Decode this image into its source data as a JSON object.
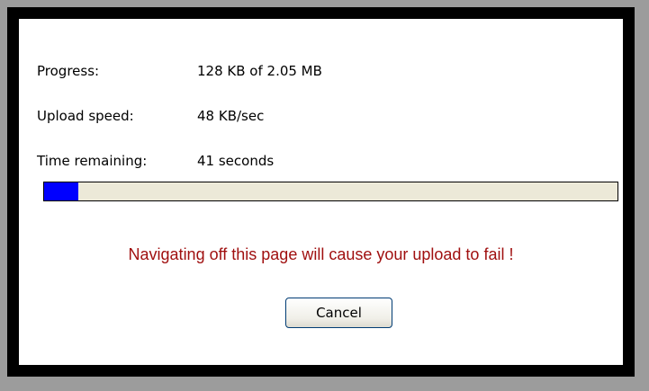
{
  "upload": {
    "progress_label": "Progress:",
    "progress_value": "128 KB of 2.05 MB",
    "speed_label": "Upload speed:",
    "speed_value": "48 KB/sec",
    "time_label": "Time remaining:",
    "time_value": "41 seconds",
    "progress_fraction": 0.06
  },
  "warning": "Navigating off this page will cause your upload to fail !",
  "cancel_label": "Cancel",
  "colors": {
    "progress_fill": "#0000ff",
    "progress_track": "#ece9d8",
    "warning_text": "#a01010"
  }
}
